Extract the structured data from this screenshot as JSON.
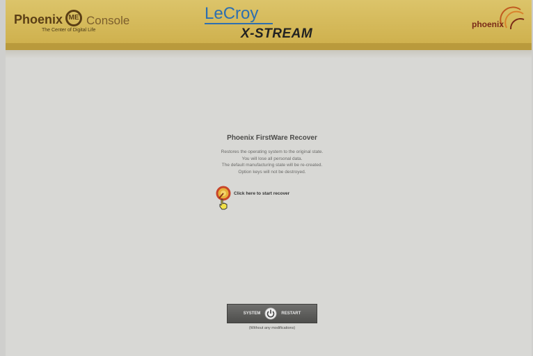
{
  "header": {
    "left_logo": {
      "brand": "Phoenix",
      "badge": "ME",
      "product": "Console",
      "tagline": "The Center of Digital Life"
    },
    "center_logo": {
      "line1": "LeCroy",
      "line2": "X-STREAM"
    },
    "right_logo": {
      "brand": "phoenix"
    }
  },
  "recover": {
    "title": "Phoenix FirstWare Recover",
    "description": [
      "Restores the operating system to the original state.",
      "You will lose all personal data.",
      "The default manufacturing state will be re-created.",
      "Option keys will not be destroyed."
    ],
    "link_label": "Click here to start recover"
  },
  "restart": {
    "left_label": "SYSTEM",
    "right_label": "RESTART",
    "note": "(Without any modifications)"
  },
  "colors": {
    "header_gold": "#d6bb5c",
    "header_band": "#b99a3c",
    "background": "#d8d8d5",
    "button": "#5e5e5c"
  }
}
